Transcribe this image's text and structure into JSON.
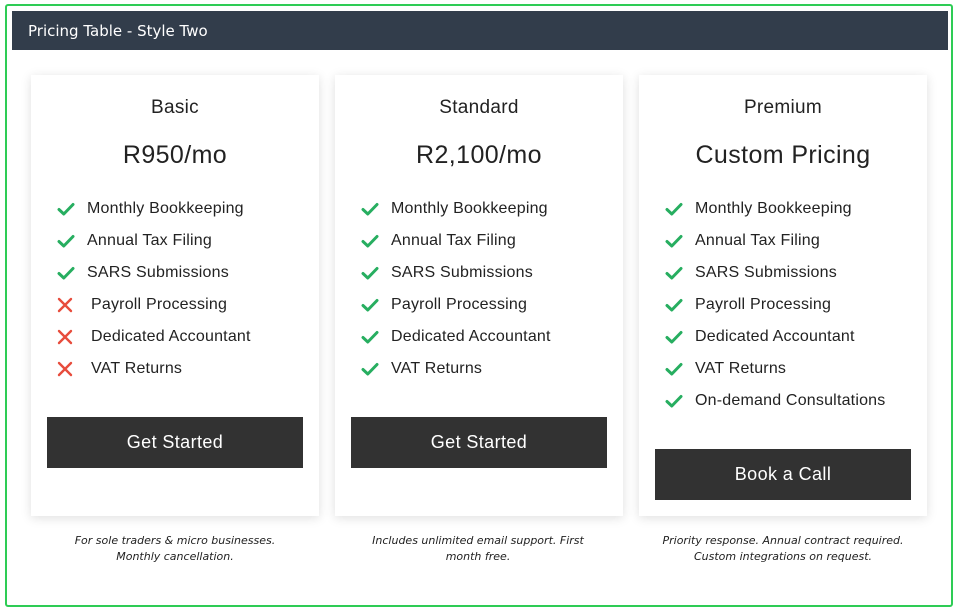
{
  "header": {
    "title": "Pricing Table - Style Two"
  },
  "colors": {
    "check": "#27ae60",
    "cross": "#e74c3c",
    "accent_border": "#2ecc55",
    "header_bg": "#323d4b",
    "button_bg": "#323232"
  },
  "plans": [
    {
      "name": "Basic",
      "price": "R950/mo",
      "features": [
        {
          "label": "Monthly Bookkeeping",
          "included": true
        },
        {
          "label": "Annual Tax Filing",
          "included": true
        },
        {
          "label": "SARS Submissions",
          "included": true
        },
        {
          "label": "Payroll Processing",
          "included": false
        },
        {
          "label": "Dedicated Accountant",
          "included": false
        },
        {
          "label": "VAT Returns",
          "included": false
        }
      ],
      "button_label": "Get Started",
      "note": "For sole traders & micro businesses. Monthly cancellation."
    },
    {
      "name": "Standard",
      "price": "R2,100/mo",
      "features": [
        {
          "label": "Monthly Bookkeeping",
          "included": true
        },
        {
          "label": "Annual Tax Filing",
          "included": true
        },
        {
          "label": "SARS Submissions",
          "included": true
        },
        {
          "label": "Payroll Processing",
          "included": true
        },
        {
          "label": "Dedicated Accountant",
          "included": true
        },
        {
          "label": "VAT Returns",
          "included": true
        }
      ],
      "button_label": "Get Started",
      "note": "Includes unlimited email support. First month free."
    },
    {
      "name": "Premium",
      "price": "Custom Pricing",
      "features": [
        {
          "label": "Monthly Bookkeeping",
          "included": true
        },
        {
          "label": "Annual Tax Filing",
          "included": true
        },
        {
          "label": "SARS Submissions",
          "included": true
        },
        {
          "label": "Payroll Processing",
          "included": true
        },
        {
          "label": "Dedicated Accountant",
          "included": true
        },
        {
          "label": "VAT Returns",
          "included": true
        },
        {
          "label": "On-demand Consultations",
          "included": true
        }
      ],
      "button_label": "Book a Call",
      "note": "Priority response. Annual contract required. Custom integrations on request."
    }
  ]
}
